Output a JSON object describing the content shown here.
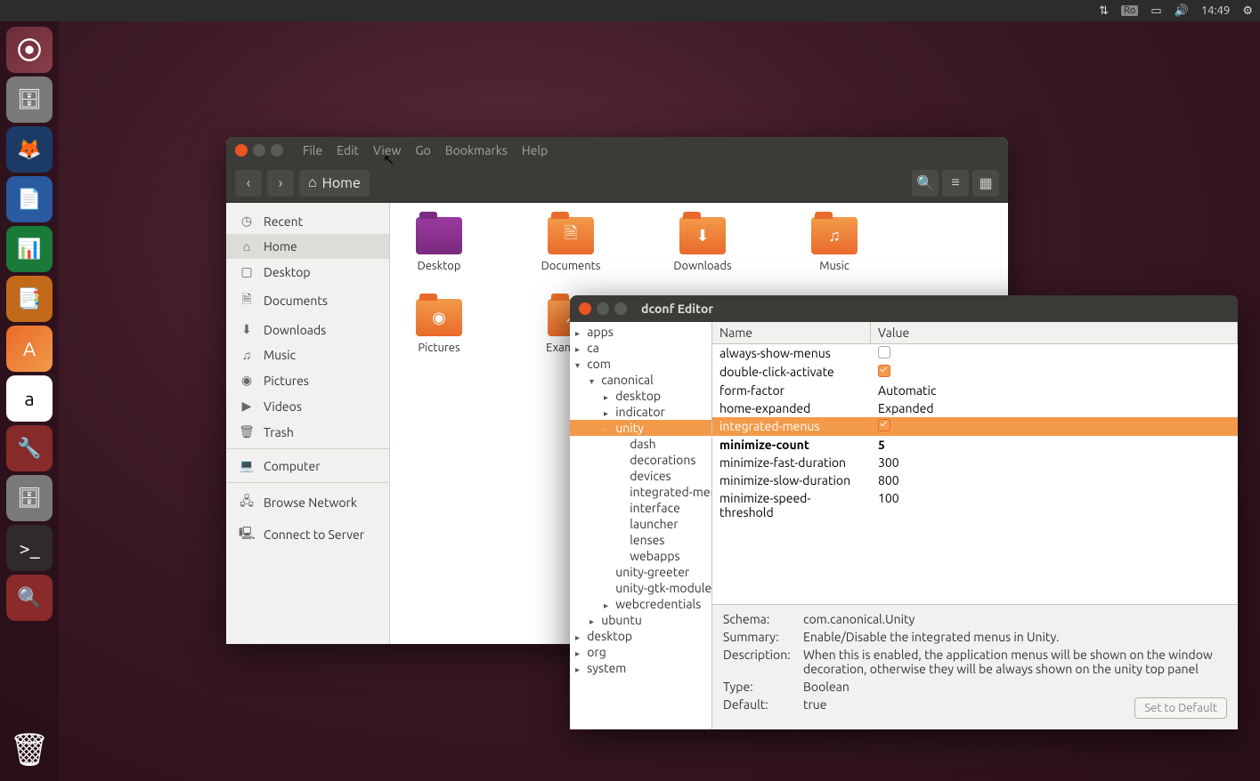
{
  "top_panel": {
    "keyboard": "Ro",
    "time": "14:49"
  },
  "nautilus": {
    "menus": [
      "File",
      "Edit",
      "View",
      "Go",
      "Bookmarks",
      "Help"
    ],
    "path": "Home",
    "sidebar": [
      {
        "icon": "◷",
        "label": "Recent"
      },
      {
        "icon": "⌂",
        "label": "Home",
        "selected": true
      },
      {
        "icon": "▢",
        "label": "Desktop"
      },
      {
        "icon": "🗎",
        "label": "Documents"
      },
      {
        "icon": "⬇",
        "label": "Downloads"
      },
      {
        "icon": "♫",
        "label": "Music"
      },
      {
        "icon": "◉",
        "label": "Pictures"
      },
      {
        "icon": "▶",
        "label": "Videos"
      },
      {
        "icon": "🗑",
        "label": "Trash"
      },
      {
        "sep": true
      },
      {
        "icon": "💻",
        "label": "Computer"
      },
      {
        "sep": true
      },
      {
        "icon": "🖧",
        "label": "Browse Network"
      },
      {
        "icon": "🖳",
        "label": "Connect to Server"
      }
    ],
    "files": [
      {
        "label": "Desktop",
        "type": "desktop",
        "over": ""
      },
      {
        "label": "Documents",
        "type": "folder",
        "over": "🗎"
      },
      {
        "label": "Downloads",
        "type": "folder",
        "over": "⬇"
      },
      {
        "label": "Music",
        "type": "folder",
        "over": "♫"
      },
      {
        "label": "Pictures",
        "type": "folder",
        "over": "◉"
      },
      {
        "label": "Examples",
        "type": "folder",
        "over": "↗"
      }
    ]
  },
  "dconf": {
    "title": "dconf Editor",
    "tree": [
      {
        "d": 0,
        "e": "▸",
        "l": "apps"
      },
      {
        "d": 0,
        "e": "▸",
        "l": "ca"
      },
      {
        "d": 0,
        "e": "▾",
        "l": "com"
      },
      {
        "d": 1,
        "e": "▾",
        "l": "canonical"
      },
      {
        "d": 2,
        "e": "▸",
        "l": "desktop"
      },
      {
        "d": 2,
        "e": "▸",
        "l": "indicator"
      },
      {
        "d": 2,
        "e": "·",
        "l": "unity",
        "sel": true
      },
      {
        "d": 3,
        "e": "",
        "l": "dash"
      },
      {
        "d": 3,
        "e": "",
        "l": "decorations"
      },
      {
        "d": 3,
        "e": "",
        "l": "devices"
      },
      {
        "d": 3,
        "e": "",
        "l": "integrated-menus"
      },
      {
        "d": 3,
        "e": "",
        "l": "interface"
      },
      {
        "d": 3,
        "e": "",
        "l": "launcher"
      },
      {
        "d": 3,
        "e": "",
        "l": "lenses"
      },
      {
        "d": 3,
        "e": "",
        "l": "webapps"
      },
      {
        "d": 2,
        "e": "",
        "l": "unity-greeter"
      },
      {
        "d": 2,
        "e": "",
        "l": "unity-gtk-module"
      },
      {
        "d": 2,
        "e": "▸",
        "l": "webcredentials"
      },
      {
        "d": 1,
        "e": "▸",
        "l": "ubuntu"
      },
      {
        "d": 0,
        "e": "▸",
        "l": "desktop"
      },
      {
        "d": 0,
        "e": "▸",
        "l": "org"
      },
      {
        "d": 0,
        "e": "▸",
        "l": "system"
      }
    ],
    "columns": {
      "name": "Name",
      "value": "Value"
    },
    "rows": [
      {
        "name": "always-show-menus",
        "value": "",
        "check": false
      },
      {
        "name": "double-click-activate",
        "value": "",
        "check": true
      },
      {
        "name": "form-factor",
        "value": "Automatic"
      },
      {
        "name": "home-expanded",
        "value": "Expanded"
      },
      {
        "name": "integrated-menus",
        "value": "",
        "check": true,
        "sel": true
      },
      {
        "name": "minimize-count",
        "value": "5",
        "bold": true
      },
      {
        "name": "minimize-fast-duration",
        "value": "300"
      },
      {
        "name": "minimize-slow-duration",
        "value": "800"
      },
      {
        "name": "minimize-speed-threshold",
        "value": "100"
      }
    ],
    "detail": {
      "schema_lbl": "Schema:",
      "schema": "com.canonical.Unity",
      "summary_lbl": "Summary:",
      "summary": "Enable/Disable the integrated menus in Unity.",
      "desc_lbl": "Description:",
      "desc": "When this is enabled, the application menus will be shown on the window decoration, otherwise they will be always shown on the unity top panel",
      "type_lbl": "Type:",
      "type": "Boolean",
      "default_lbl": "Default:",
      "default": "true",
      "button": "Set to Default"
    }
  }
}
